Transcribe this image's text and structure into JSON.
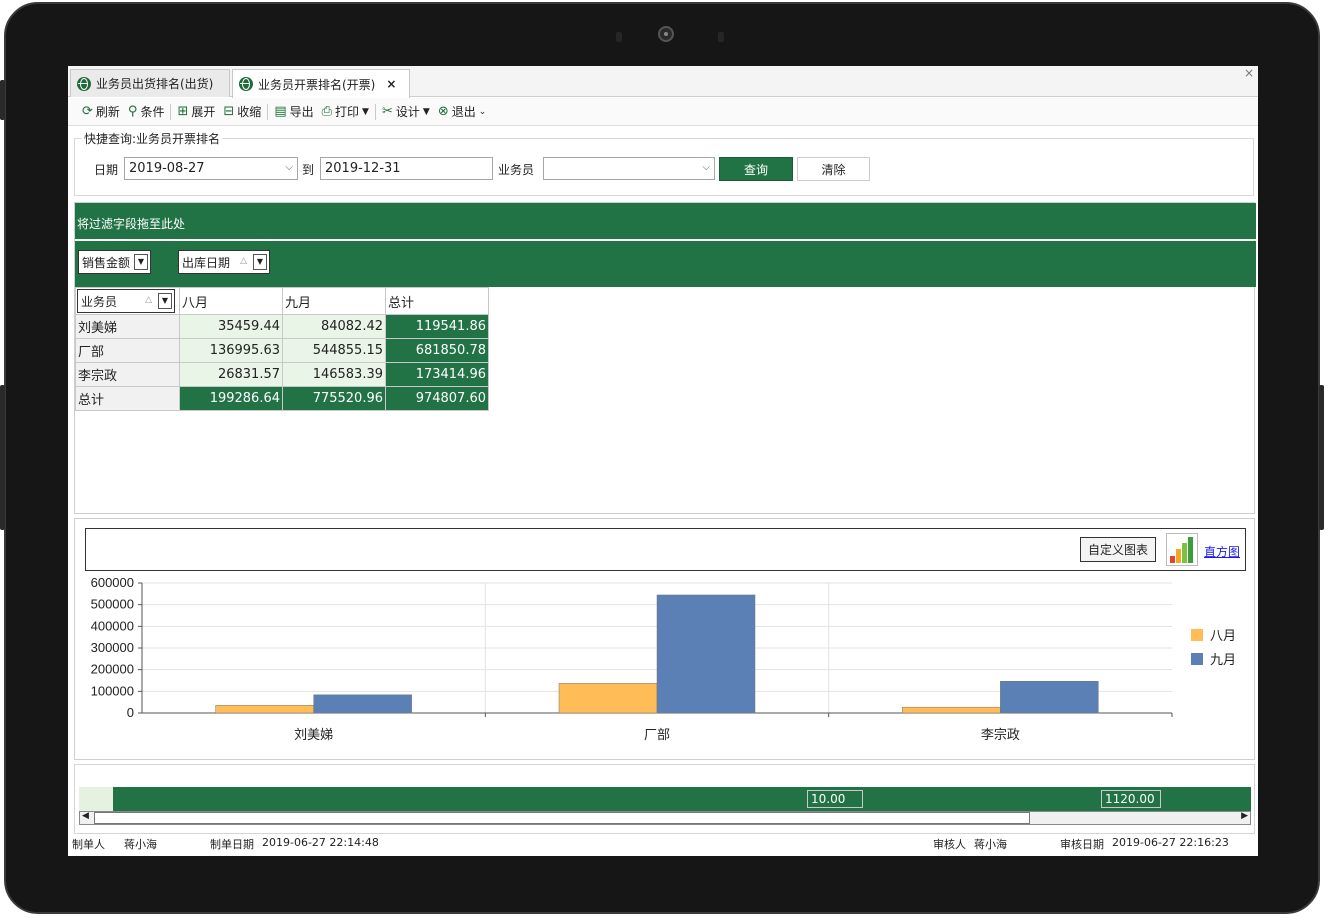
{
  "tabs": [
    {
      "label": "业务员出货排名(出货)"
    },
    {
      "label": "业务员开票排名(开票)",
      "close": "×"
    }
  ],
  "window_close": "×",
  "toolbar": {
    "refresh": "刷新",
    "condition": "条件",
    "expand": "展开",
    "collapse": "收缩",
    "export": "导出",
    "print": "打印",
    "design": "设计",
    "exit": "退出"
  },
  "quick_search": {
    "title": "快捷查询:业务员开票排名",
    "date_label": "日期",
    "date_from": "2019-08-27",
    "to_label": "到",
    "date_to": "2019-12-31",
    "salesman_label": "业务员",
    "salesman_value": "",
    "query_button": "查询",
    "clear_button": "清除"
  },
  "pivot": {
    "filter_hint": "将过滤字段拖至此处",
    "data_field": "销售金额",
    "column_field": "出库日期",
    "row_field": "业务员",
    "columns": [
      "八月",
      "九月",
      "总计"
    ],
    "rows": [
      {
        "name": "刘美娣",
        "values": [
          "35459.44",
          "84082.42",
          "119541.86"
        ]
      },
      {
        "name": "厂部",
        "values": [
          "136995.63",
          "544855.15",
          "681850.78"
        ]
      },
      {
        "name": "李宗政",
        "values": [
          "26831.57",
          "146583.39",
          "173414.96"
        ]
      }
    ],
    "total": {
      "name": "总计",
      "values": [
        "199286.64",
        "775520.96",
        "974807.60"
      ]
    }
  },
  "chart_panel": {
    "custom_button": "自定义图表",
    "chart_type_link": "直方图"
  },
  "chart_data": {
    "type": "bar",
    "categories": [
      "刘美娣",
      "厂部",
      "李宗政"
    ],
    "series": [
      {
        "name": "八月",
        "values": [
          35459.44,
          136995.63,
          26831.57
        ],
        "color": "#ffbc57"
      },
      {
        "name": "九月",
        "values": [
          84082.42,
          544855.15,
          146583.39
        ],
        "color": "#5b80b5"
      }
    ],
    "yticks": [
      "600000",
      "500000",
      "400000",
      "300000",
      "200000",
      "100000",
      "0"
    ],
    "ylim": [
      0,
      600000
    ],
    "grid": true,
    "legend_position": "right"
  },
  "summary": {
    "cell1": "10.00",
    "cell2": "1120.00"
  },
  "footer": {
    "maker_label": "制单人",
    "maker": "蒋小海",
    "make_date_label": "制单日期",
    "make_date": "2019-06-27 22:14:48",
    "auditor_label": "审核人",
    "auditor": "蒋小海",
    "audit_date_label": "审核日期",
    "audit_date": "2019-06-27 22:16:23"
  }
}
